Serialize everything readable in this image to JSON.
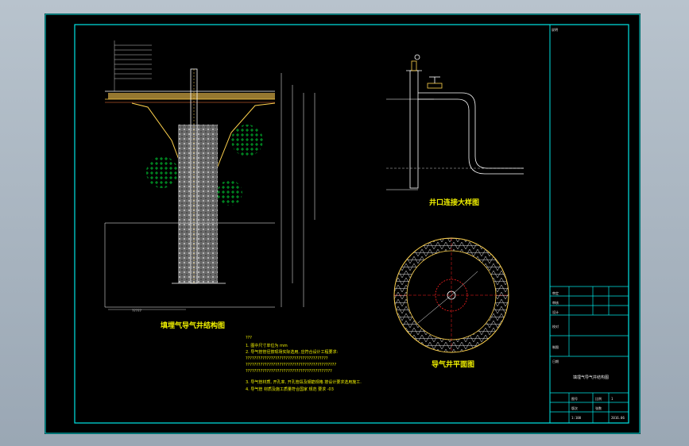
{
  "colors": {
    "background": "#000000",
    "frame": "#00e5e5",
    "title_text": "#f2f200",
    "lines": "#ffffff",
    "hatch": "#00cc33",
    "accent": "#ff2020",
    "fill": "#c8a040"
  },
  "drawing": {
    "title_left": "填埋气导气井结构图",
    "title_right_top": "井口连接大样图",
    "title_right_bottom": "导气井平面图",
    "bottom_marker": "?????"
  },
  "notes": {
    "heading": "???",
    "lines": [
      "1. 图中尺寸单位为 mm",
      "2. 导气管管径按现场实际选用, 应符合设计工程要求:",
      "???????????????????????????????????????",
      "???????????????????????????????????????????",
      "?????????????????????????????????????????",
      "3. 导气管材质, 开孔率, 开孔管段及钢筋规格 按设计要求选用施工.",
      "4. 导气管 材质及施工质量符合国家 规范 要求 -03"
    ]
  },
  "title_block": {
    "corner_label": "说明",
    "rows": [
      "审定",
      "审核",
      "设计",
      "校对",
      "制图",
      "日期"
    ],
    "project_label": "填埋气导气井结构图",
    "fields": [
      "图号",
      "比例",
      "版次",
      "张数"
    ],
    "values": [
      "1",
      "1:100",
      "2016.06"
    ]
  }
}
